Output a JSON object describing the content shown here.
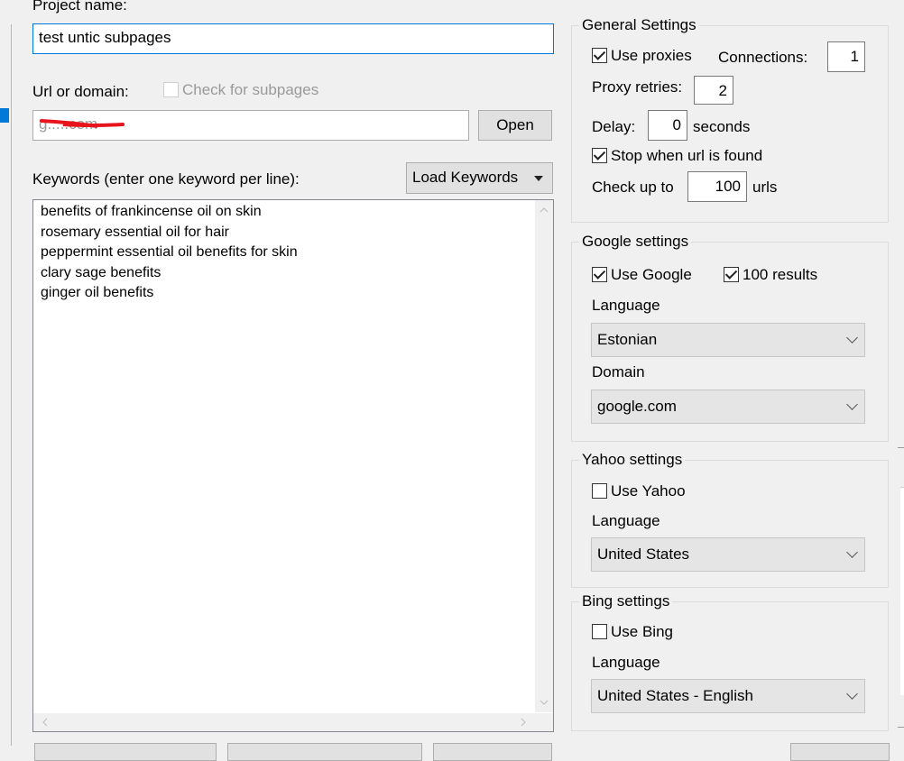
{
  "project": {
    "name_label": "Project name:",
    "name_value": "test untic subpages"
  },
  "url": {
    "label": "Url or domain:",
    "check_subpages_label": "Check for subpages",
    "value": "g.....com",
    "open_button": "Open"
  },
  "keywords": {
    "label": "Keywords (enter one keyword per line):",
    "load_button": "Load Keywords",
    "items": [
      "benefits of frankincense oil on skin",
      "rosemary essential oil for hair",
      "peppermint essential oil benefits for skin",
      "clary sage benefits",
      "ginger oil benefits"
    ]
  },
  "general": {
    "title": "General Settings",
    "use_proxies": "Use proxies",
    "connections_label": "Connections:",
    "connections_value": "1",
    "proxy_retries_label": "Proxy retries:",
    "proxy_retries_value": "2",
    "delay_label": "Delay:",
    "delay_value": "0",
    "delay_unit": "seconds",
    "stop_label": "Stop when url is found",
    "check_up_label": "Check up to",
    "check_up_value": "100",
    "check_up_unit": "urls"
  },
  "google": {
    "title": "Google settings",
    "use_label": "Use Google",
    "results_label": "100 results",
    "language_label": "Language",
    "language_value": "Estonian",
    "domain_label": "Domain",
    "domain_value": "google.com"
  },
  "yahoo": {
    "title": "Yahoo settings",
    "use_label": "Use Yahoo",
    "language_label": "Language",
    "language_value": "United States"
  },
  "bing": {
    "title": "Bing settings",
    "use_label": "Use Bing",
    "language_label": "Language",
    "language_value": "United States - English"
  },
  "colors": {
    "accent": "#0078d7",
    "annotation": "#e8141c"
  },
  "icons": {
    "dropdown": "chevron-down-icon",
    "check": "checkmark-icon",
    "scroll_up": "scroll-up-arrow-icon",
    "scroll_down": "scroll-down-arrow-icon",
    "scroll_left": "scroll-left-arrow-icon",
    "scroll_right": "scroll-right-arrow-icon"
  }
}
